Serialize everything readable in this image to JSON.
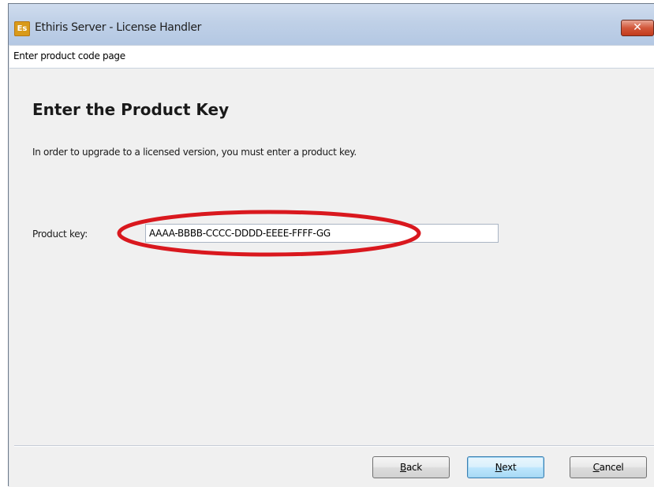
{
  "window": {
    "title": "Ethiris Server - License Handler",
    "app_icon_text": "Es",
    "close_glyph": "✕"
  },
  "page": {
    "header": "Enter product code page",
    "heading": "Enter the Product Key",
    "instructions": "In order to upgrade to a licensed version, you must enter a product key."
  },
  "form": {
    "product_key_label": "Product key:",
    "product_key_value": "AAAA-BBBB-CCCC-DDDD-EEEE-FFFF-GG"
  },
  "buttons": {
    "back": {
      "mnemonic": "B",
      "rest": "ack"
    },
    "next": {
      "mnemonic": "N",
      "rest": "ext"
    },
    "cancel": {
      "mnemonic": "C",
      "rest": "ancel"
    }
  },
  "colors": {
    "highlight_ellipse": "#d9181e",
    "titlebar": "#bfd0e7",
    "close_button": "#c94a2c",
    "dialog_background": "#f0f0f0"
  },
  "icons": {
    "app": "ethiris-server-app-icon",
    "close": "close-icon"
  }
}
